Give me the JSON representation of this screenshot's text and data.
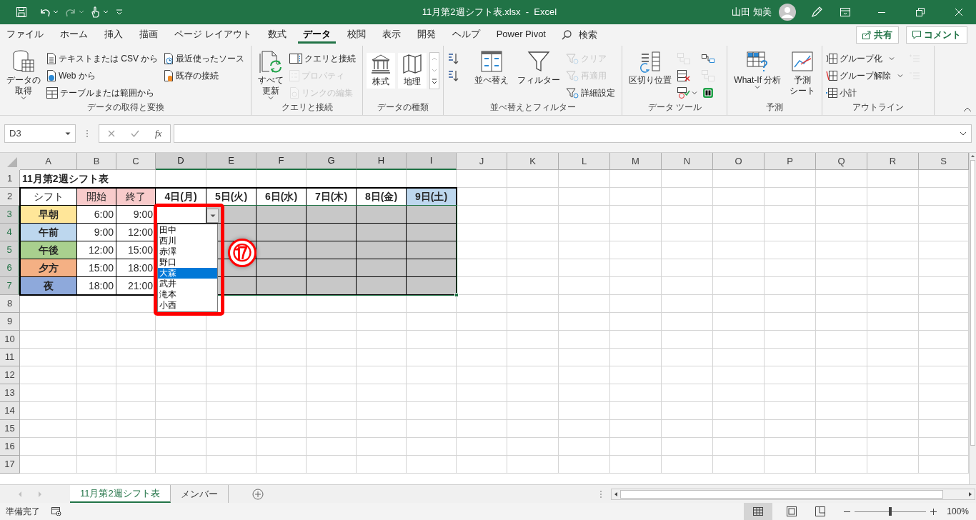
{
  "window": {
    "title": "11月第2週シフト表.xlsx  -  Excel",
    "user": "山田 知美"
  },
  "ribbon_tabs": [
    {
      "label": "ファイル",
      "selected": false
    },
    {
      "label": "ホーム",
      "selected": false
    },
    {
      "label": "挿入",
      "selected": false
    },
    {
      "label": "描画",
      "selected": false
    },
    {
      "label": "ページ レイアウト",
      "selected": false
    },
    {
      "label": "数式",
      "selected": false
    },
    {
      "label": "データ",
      "selected": true
    },
    {
      "label": "校閲",
      "selected": false
    },
    {
      "label": "表示",
      "selected": false
    },
    {
      "label": "開発",
      "selected": false
    },
    {
      "label": "ヘルプ",
      "selected": false
    },
    {
      "label": "Power Pivot",
      "selected": false
    }
  ],
  "search": {
    "label": "検索"
  },
  "share_button": "共有",
  "comment_button": "コメント",
  "ribbon_groups": [
    {
      "label": "データの取得と変換",
      "items": [
        {
          "kind": "large",
          "lines": [
            "データの",
            "取得"
          ],
          "dropdown": true,
          "disabled": false
        },
        {
          "kind": "small",
          "label": "テキストまたは CSV から",
          "dropdown": false,
          "disabled": false
        },
        {
          "kind": "small",
          "label": "Web から",
          "dropdown": false,
          "disabled": false
        },
        {
          "kind": "small",
          "label": "テーブルまたは範囲から",
          "dropdown": false,
          "disabled": false
        },
        {
          "kind": "small",
          "label": "最近使ったソース",
          "dropdown": false,
          "disabled": false
        },
        {
          "kind": "small",
          "label": "既存の接続",
          "dropdown": false,
          "disabled": false
        }
      ]
    },
    {
      "label": "クエリと接続",
      "items": [
        {
          "kind": "large",
          "lines": [
            "すべて",
            "更新"
          ],
          "dropdown": true,
          "disabled": false
        },
        {
          "kind": "small",
          "label": "クエリと接続",
          "dropdown": false,
          "disabled": false
        },
        {
          "kind": "small",
          "label": "プロパティ",
          "dropdown": false,
          "disabled": true
        },
        {
          "kind": "small",
          "label": "リンクの編集",
          "dropdown": false,
          "disabled": true
        }
      ]
    },
    {
      "label": "データの種類",
      "items": [
        {
          "kind": "tile",
          "label": "株式",
          "dropdown": false,
          "disabled": false
        },
        {
          "kind": "tile",
          "label": "地理",
          "dropdown": false,
          "disabled": false
        },
        {
          "kind": "gallery"
        }
      ]
    },
    {
      "label": "並べ替えとフィルター",
      "items": [
        {
          "kind": "icon",
          "dropdown": false,
          "disabled": false
        },
        {
          "kind": "icon",
          "dropdown": false,
          "disabled": false
        },
        {
          "kind": "large",
          "lines": [
            "並べ替え"
          ],
          "dropdown": false,
          "disabled": false
        },
        {
          "kind": "large",
          "lines": [
            "フィルター"
          ],
          "dropdown": false,
          "disabled": false
        },
        {
          "kind": "small",
          "label": "クリア",
          "dropdown": false,
          "disabled": true
        },
        {
          "kind": "small",
          "label": "再適用",
          "dropdown": false,
          "disabled": true
        },
        {
          "kind": "small",
          "label": "詳細設定",
          "dropdown": false,
          "disabled": false
        }
      ]
    },
    {
      "label": "データ ツール",
      "items": [
        {
          "kind": "large",
          "lines": [
            "区切り位置"
          ],
          "dropdown": false,
          "disabled": false
        },
        {
          "kind": "icon",
          "dropdown": false,
          "disabled": true
        },
        {
          "kind": "icon",
          "dropdown": false,
          "disabled": false
        },
        {
          "kind": "icon",
          "dropdown": true,
          "disabled": false
        },
        {
          "kind": "icon",
          "dropdown": false,
          "disabled": false
        },
        {
          "kind": "icon",
          "dropdown": false,
          "disabled": true
        },
        {
          "kind": "icon",
          "dropdown": false,
          "disabled": false
        }
      ]
    },
    {
      "label": "予測",
      "items": [
        {
          "kind": "large",
          "lines": [
            "What-If 分析"
          ],
          "dropdown": true,
          "disabled": false
        },
        {
          "kind": "large",
          "lines": [
            "予測",
            "シート"
          ],
          "dropdown": false,
          "disabled": false
        }
      ]
    },
    {
      "label": "アウトライン",
      "items": [
        {
          "kind": "small",
          "label": "グループ化",
          "dropdown": true,
          "disabled": false
        },
        {
          "kind": "small",
          "label": "グループ解除",
          "dropdown": true,
          "disabled": false
        },
        {
          "kind": "small",
          "label": "小計",
          "dropdown": false,
          "disabled": false
        },
        {
          "kind": "icon",
          "dropdown": false,
          "disabled": true
        },
        {
          "kind": "icon",
          "dropdown": false,
          "disabled": true
        }
      ]
    }
  ],
  "formula_bar": {
    "name_box": "D3",
    "function_button": "fx"
  },
  "sheet": {
    "columns": [
      {
        "label": "A",
        "selected": false
      },
      {
        "label": "B",
        "selected": false
      },
      {
        "label": "C",
        "selected": false
      },
      {
        "label": "D",
        "selected": true
      },
      {
        "label": "E",
        "selected": true
      },
      {
        "label": "F",
        "selected": true
      },
      {
        "label": "G",
        "selected": true
      },
      {
        "label": "H",
        "selected": true
      },
      {
        "label": "I",
        "selected": true
      },
      {
        "label": "J",
        "selected": false
      },
      {
        "label": "K",
        "selected": false
      },
      {
        "label": "L",
        "selected": false
      },
      {
        "label": "M",
        "selected": false
      },
      {
        "label": "N",
        "selected": false
      },
      {
        "label": "O",
        "selected": false
      },
      {
        "label": "P",
        "selected": false
      },
      {
        "label": "Q",
        "selected": false
      },
      {
        "label": "R",
        "selected": false
      },
      {
        "label": "S",
        "selected": false
      }
    ],
    "rows": [
      {
        "number": "1",
        "selected": false,
        "cells": [
          {
            "text": "11月第2週シフト表"
          }
        ]
      },
      {
        "number": "2",
        "selected": false,
        "cells": [
          {
            "text": "シフト"
          },
          {
            "text": "開始",
            "color": "#f8cbcb"
          },
          {
            "text": "終了",
            "color": "#f8cbcb"
          },
          {
            "text": "4日(月)"
          },
          {
            "text": "5日(火)"
          },
          {
            "text": "6日(水)"
          },
          {
            "text": "7日(木)"
          },
          {
            "text": "8日(金)"
          },
          {
            "text": "9日(土)",
            "color": "#bdd7ee"
          }
        ]
      },
      {
        "number": "3",
        "selected": true,
        "cells": [
          {
            "text": "早朝",
            "color": "#ffe699"
          },
          {
            "text": "6:00"
          },
          {
            "text": "9:00"
          },
          {},
          {
            "color": "#c8c8c8"
          },
          {
            "color": "#c8c8c8"
          },
          {
            "color": "#c8c8c8"
          },
          {
            "color": "#c8c8c8"
          },
          {
            "color": "#c8c8c8"
          }
        ]
      },
      {
        "number": "4",
        "selected": true,
        "cells": [
          {
            "text": "午前",
            "color": "#bdd7ee"
          },
          {
            "text": "9:00"
          },
          {
            "text": "12:00"
          },
          null,
          {
            "color": "#c8c8c8"
          },
          {
            "color": "#c8c8c8"
          },
          {
            "color": "#c8c8c8"
          },
          {
            "color": "#c8c8c8"
          },
          {
            "color": "#c8c8c8"
          }
        ]
      },
      {
        "number": "5",
        "selected": true,
        "cells": [
          {
            "text": "午後",
            "color": "#a9d08e"
          },
          {
            "text": "12:00"
          },
          {
            "text": "15:00"
          },
          null,
          {
            "color": "#c8c8c8"
          },
          {
            "color": "#c8c8c8"
          },
          {
            "color": "#c8c8c8"
          },
          {
            "color": "#c8c8c8"
          },
          {
            "color": "#c8c8c8"
          }
        ]
      },
      {
        "number": "6",
        "selected": true,
        "cells": [
          {
            "text": "夕方",
            "color": "#f4b084"
          },
          {
            "text": "15:00"
          },
          {
            "text": "18:00"
          },
          null,
          {
            "color": "#c8c8c8"
          },
          {
            "color": "#c8c8c8"
          },
          {
            "color": "#c8c8c8"
          },
          {
            "color": "#c8c8c8"
          },
          {
            "color": "#c8c8c8"
          }
        ]
      },
      {
        "number": "7",
        "selected": true,
        "cells": [
          {
            "text": "夜",
            "color": "#8ea9db"
          },
          {
            "text": "18:00"
          },
          {
            "text": "21:00"
          },
          null,
          {
            "color": "#c8c8c8"
          },
          {
            "color": "#c8c8c8"
          },
          {
            "color": "#c8c8c8"
          },
          {
            "color": "#c8c8c8"
          },
          {
            "color": "#c8c8c8"
          }
        ]
      },
      {
        "number": "8",
        "selected": false,
        "cells": []
      },
      {
        "number": "9",
        "selected": false,
        "cells": []
      },
      {
        "number": "10",
        "selected": false,
        "cells": []
      },
      {
        "number": "11",
        "selected": false,
        "cells": []
      },
      {
        "number": "12",
        "selected": false,
        "cells": []
      },
      {
        "number": "13",
        "selected": false,
        "cells": []
      },
      {
        "number": "14",
        "selected": false,
        "cells": []
      },
      {
        "number": "15",
        "selected": false,
        "cells": []
      },
      {
        "number": "16",
        "selected": false,
        "cells": []
      },
      {
        "number": "17",
        "selected": false,
        "cells": []
      }
    ]
  },
  "dropdown_list": {
    "items": [
      {
        "label": "田中",
        "selected": false
      },
      {
        "label": "西川",
        "selected": false
      },
      {
        "label": "赤澤",
        "selected": false
      },
      {
        "label": "野口",
        "selected": false
      },
      {
        "label": "大森",
        "selected": true
      },
      {
        "label": "武井",
        "selected": false
      },
      {
        "label": "滝本",
        "selected": false
      },
      {
        "label": "小西",
        "selected": false
      }
    ]
  },
  "annotation": {
    "label": "⑰"
  },
  "sheet_tabs": [
    {
      "label": "11月第2週シフト表",
      "selected": true
    },
    {
      "label": "メンバー",
      "selected": false
    }
  ],
  "status_bar": {
    "text": "準備完了",
    "zoom": "100%",
    "zoom_level": {
      "level": 0.5
    }
  }
}
